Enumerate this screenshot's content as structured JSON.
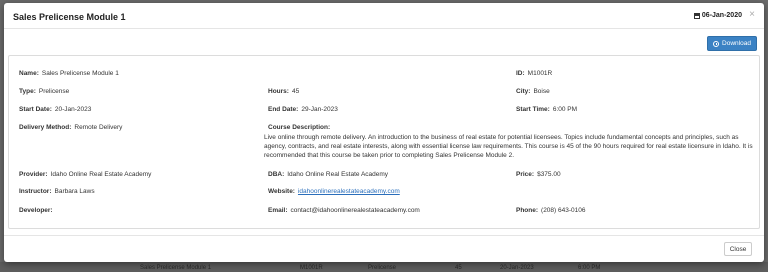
{
  "modal": {
    "title": "Sales Prelicense Module 1",
    "date": "06-Jan-2020",
    "close_symbol": "×",
    "download_label": "Download",
    "close_label": "Close"
  },
  "fields": {
    "name": {
      "label": "Name:",
      "value": "Sales Prelicense Module 1"
    },
    "id": {
      "label": "ID:",
      "value": "M1001R"
    },
    "type": {
      "label": "Type:",
      "value": "Prelicense"
    },
    "hours": {
      "label": "Hours:",
      "value": "45"
    },
    "city": {
      "label": "City:",
      "value": "Boise"
    },
    "start_date": {
      "label": "Start Date:",
      "value": "20-Jan-2023"
    },
    "end_date": {
      "label": "End Date:",
      "value": "29-Jan-2023"
    },
    "start_time": {
      "label": "Start Time:",
      "value": "6:00 PM"
    },
    "delivery_method": {
      "label": "Delivery Method:",
      "value": "Remote Delivery"
    },
    "course_description": {
      "label": "Course Description:",
      "value": "Live online through remote delivery. An introduction to the business of real estate for potential licensees. Topics include fundamental concepts and principles, such as agency, contracts, and real estate interests, along with essential license law requirements. This course is 45 of the 90 hours required for real estate licensure in Idaho. It is recommended that this course be taken prior to completing Sales Prelicense Module 2."
    },
    "provider": {
      "label": "Provider:",
      "value": "Idaho Online Real Estate Academy"
    },
    "dba": {
      "label": "DBA:",
      "value": "Idaho Online Real Estate Academy"
    },
    "price": {
      "label": "Price:",
      "value": "$375.00"
    },
    "instructor": {
      "label": "Instructor:",
      "value": "Barbara Laws"
    },
    "website": {
      "label": "Website:",
      "value": "idahoonlinerealestateacademy.com"
    },
    "developer": {
      "label": "Developer:",
      "value": ""
    },
    "email": {
      "label": "Email:",
      "value": "contact@idahoonlinerealestateacademy.com"
    },
    "phone": {
      "label": "Phone:",
      "value": "(208) 643-0106"
    }
  },
  "backdrop_row": {
    "name": "Sales Prelicense Module 1",
    "id": "M1001R",
    "type": "Prelicense",
    "hours": "45",
    "date": "20-Jan-2023",
    "time": "6:00 PM"
  }
}
